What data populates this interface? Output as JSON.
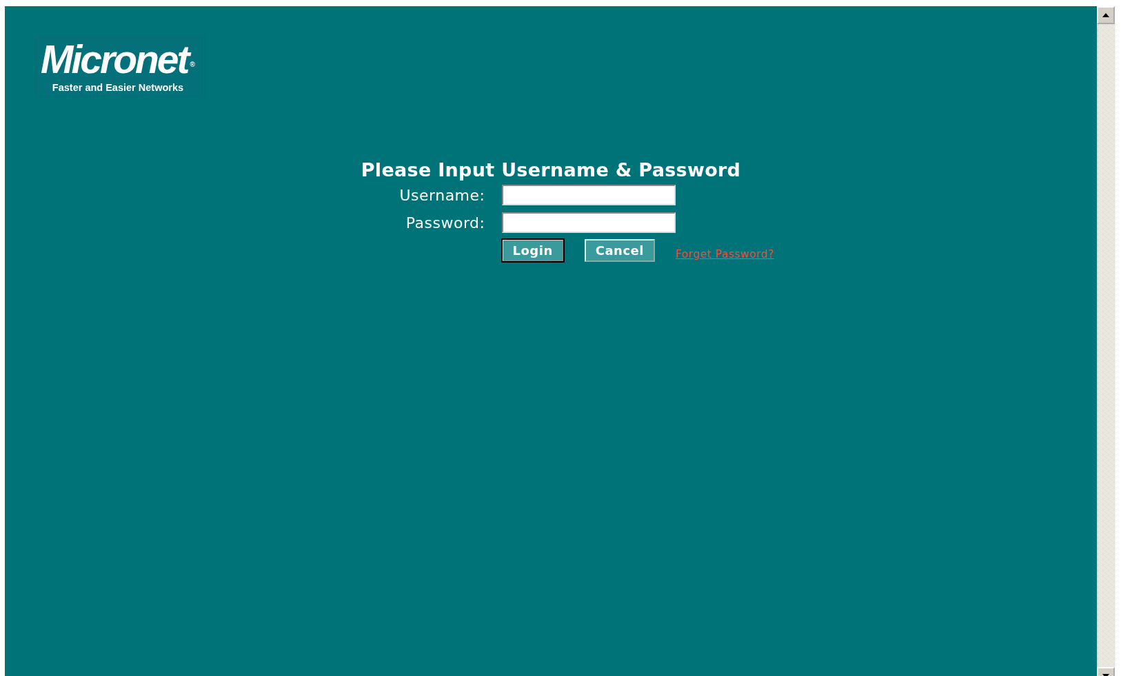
{
  "logo": {
    "name": "Micronet",
    "mark": "®",
    "tagline": "Faster and Easier Networks"
  },
  "login": {
    "title": "Please Input Username & Password",
    "fields": [
      {
        "label": "Username:"
      },
      {
        "label": "Password:"
      }
    ],
    "buttons": [
      {
        "label": "Login",
        "focused": true
      },
      {
        "label": "Cancel",
        "focused": false
      }
    ],
    "link": "Forget Password?"
  }
}
